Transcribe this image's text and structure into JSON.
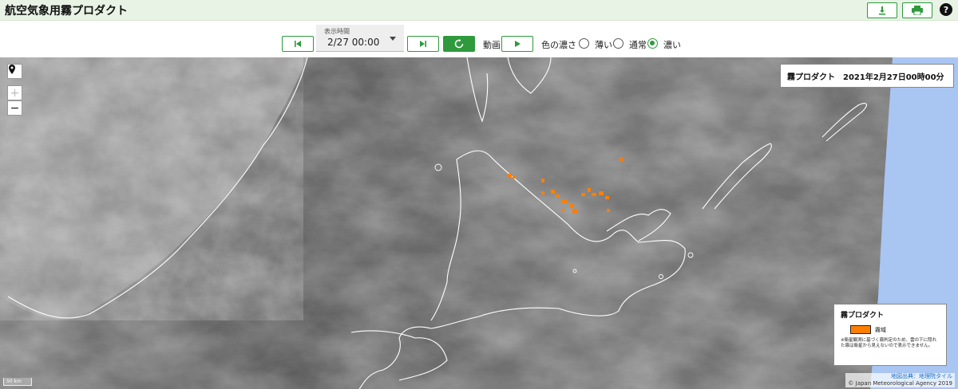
{
  "header": {
    "title": "航空気象用霧プロダクト",
    "download_icon": "download-icon",
    "print_icon": "print-icon",
    "help_glyph": "?"
  },
  "toolbar": {
    "time_label": "表示時間",
    "time_value": "2/27 00:00",
    "animation_label": "動画",
    "color_depth_label": "色の濃さ",
    "opacity_options": [
      {
        "label": "薄い",
        "selected": false
      },
      {
        "label": "通常",
        "selected": false
      },
      {
        "label": "濃い",
        "selected": true
      }
    ]
  },
  "map": {
    "info_product": "霧プロダクト",
    "info_datetime": "2021年2月27日00時00分",
    "zoom_in": "+",
    "zoom_out": "−",
    "scale_label": "50 km",
    "attribution_link": "地図出典：地理院タイル",
    "attribution_copy": "© Japan Meteorological Agency 2019",
    "legend": {
      "title": "霧プロダクト",
      "item_label": "霧域",
      "item_color": "#ff7f00",
      "note": "※衛星観測に基づく霧判定のため、雲の下に隠れた霧は衛星から見えないので表示できません。"
    },
    "colors": {
      "accent": "#2e9a3c",
      "fog": "#ff7f00",
      "sea_outside": "#a9c5f2"
    }
  }
}
